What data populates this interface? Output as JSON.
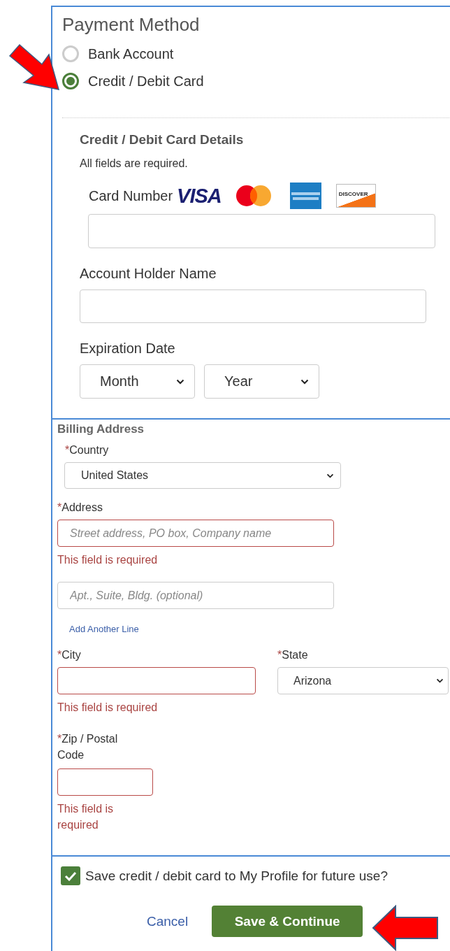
{
  "payment_method": {
    "title": "Payment Method",
    "options": [
      {
        "label": "Bank Account",
        "selected": false
      },
      {
        "label": "Credit / Debit Card",
        "selected": true
      }
    ]
  },
  "card_details": {
    "title": "Credit / Debit Card Details",
    "note": "All fields are required.",
    "card_number": {
      "label": "Card Number",
      "logos": [
        {
          "kind": "visa",
          "text": "VISA"
        },
        {
          "kind": "mastercard"
        },
        {
          "kind": "amex"
        },
        {
          "kind": "discover",
          "text": "DISCOVER"
        }
      ]
    },
    "holder_name": {
      "label": "Account Holder Name"
    },
    "expiration": {
      "label": "Expiration Date",
      "month": "Month",
      "year": "Year"
    }
  },
  "billing": {
    "title": "Billing Address",
    "country": {
      "mark": "*",
      "label": "Country",
      "value": "United States"
    },
    "address": {
      "mark": "*",
      "label": "Address",
      "placeholder": "Street address, PO box, Company name",
      "invalid": true,
      "error": "This field is required"
    },
    "address_2": {
      "placeholder": "Apt., Suite, Bldg. (optional)",
      "invalid": false
    },
    "add_line": "Add Another Line",
    "city": {
      "mark": "*",
      "label": "City",
      "invalid": true,
      "error": "This field is required"
    },
    "state": {
      "mark": "*",
      "label": "State",
      "value": "Arizona"
    },
    "zip": {
      "mark": "*",
      "label": "Zip / Postal Code",
      "invalid": true,
      "error": "This field is required"
    }
  },
  "save_card": {
    "label": "Save credit / debit card to My Profile for future use?",
    "checked": true
  },
  "buttons": {
    "cancel": "Cancel",
    "submit": "Save & Continue"
  }
}
